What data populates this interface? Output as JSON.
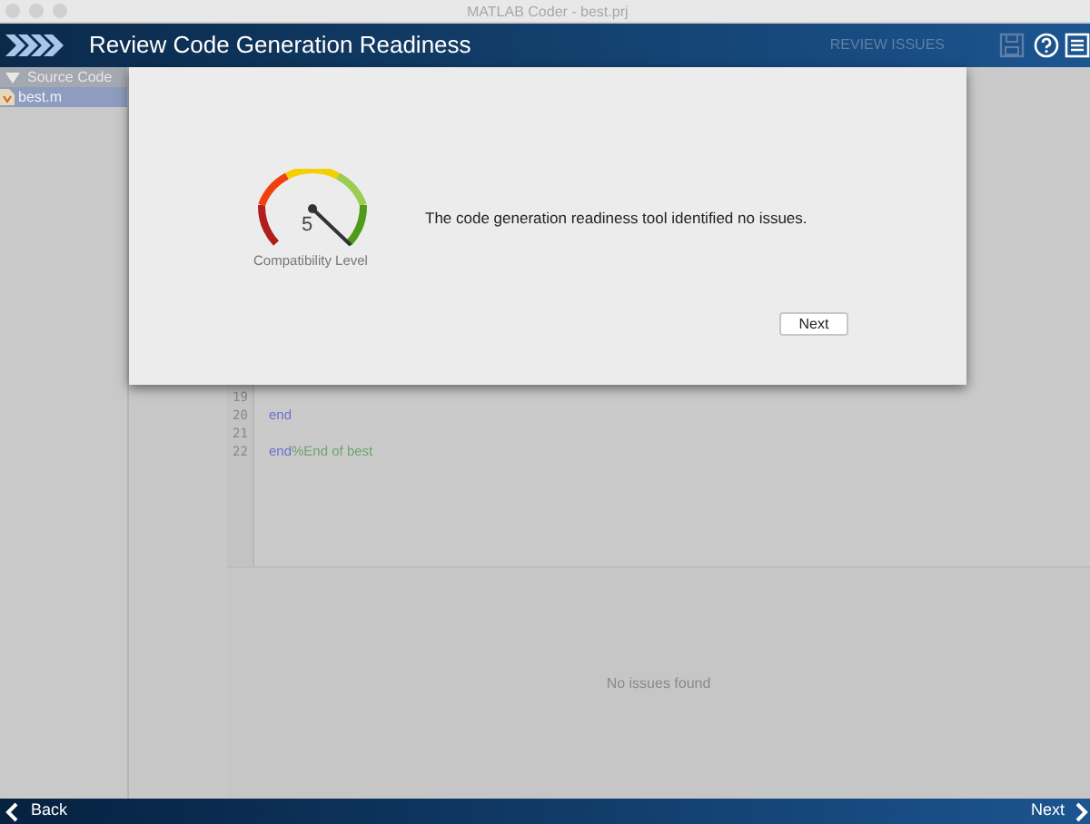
{
  "window": {
    "title": "MATLAB Coder - best.prj"
  },
  "header": {
    "title": "Review Code Generation Readiness",
    "step_label": "REVIEW ISSUES"
  },
  "sidebar": {
    "section": "Source Code",
    "expanded": true,
    "files": [
      {
        "name": "best.m",
        "selected": true
      }
    ]
  },
  "editor": {
    "lines": [
      {
        "number": "19"
      },
      {
        "number": "20",
        "tokens": [
          {
            "kind": "keyword",
            "text": "end"
          }
        ]
      },
      {
        "number": "21"
      },
      {
        "number": "22",
        "tokens": [
          {
            "kind": "keyword",
            "text": "end"
          },
          {
            "kind": "comment",
            "text": "%End of best"
          }
        ]
      }
    ]
  },
  "issues_panel": {
    "message": "No issues found"
  },
  "dialog": {
    "gauge_value": "5",
    "gauge_label": "Compatibility Level",
    "message": "The code generation readiness tool identified no issues.",
    "button": "Next"
  },
  "footer": {
    "back": "Back",
    "next": "Next"
  }
}
